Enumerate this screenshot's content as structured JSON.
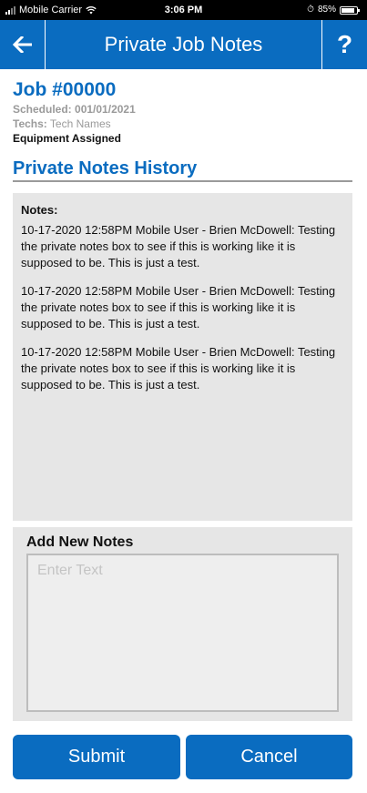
{
  "status_bar": {
    "carrier": "Mobile Carrier",
    "time": "3:06 PM",
    "battery": "85%"
  },
  "header": {
    "title": "Private Job Notes",
    "help_label": "?",
    "icons": {
      "back": "arrow-left-icon",
      "help": "question-icon"
    }
  },
  "job": {
    "number": "Job #00000",
    "scheduled_label": "Scheduled:",
    "scheduled_value": "001/01/2021",
    "techs_label": "Techs:",
    "techs_value": "Tech Names",
    "equipment": "Equipment Assigned"
  },
  "history": {
    "title": "Private Notes History",
    "notes_label": "Notes:",
    "entries": [
      "10-17-2020 12:58PM Mobile User - Brien McDowell: Testing the private notes box to see if this is working like it is supposed to be.  This is just a test.",
      "10-17-2020 12:58PM Mobile User - Brien McDowell: Testing the private notes box to see if this is working like it is supposed to be.  This is just a test.",
      "10-17-2020 12:58PM Mobile User - Brien McDowell: Testing the private notes box to see if this is working like it is supposed to be.  This is just a test."
    ]
  },
  "add_notes": {
    "label": "Add New Notes",
    "placeholder": "Enter Text",
    "value": ""
  },
  "buttons": {
    "submit": "Submit",
    "cancel": "Cancel"
  },
  "colors": {
    "accent": "#0a6cc0",
    "panel": "#e6e6e6"
  }
}
